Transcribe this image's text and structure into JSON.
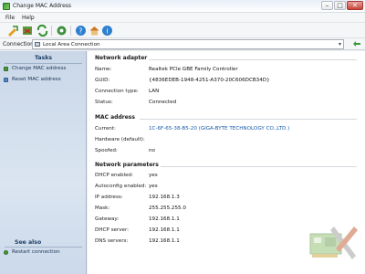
{
  "window": {
    "title": "Change MAC Address"
  },
  "titlebar_buttons": {
    "minimize": "–",
    "maximize": "□",
    "close": "✕"
  },
  "menu": [
    "File",
    "Help"
  ],
  "toolbar": {
    "buttons": [
      "apply-icon",
      "reset-icon",
      "restart-icon",
      "settings-icon",
      "help-icon",
      "home-icon",
      "info-icon"
    ]
  },
  "connection": {
    "label": "Connection:",
    "value": "Local Area Connection"
  },
  "tasks": {
    "header": "Tasks",
    "items": [
      "Change MAC address",
      "Reset MAC address"
    ],
    "see_also_header": "See also",
    "see_also_items": [
      "Restart connection"
    ]
  },
  "network_adapter": {
    "title": "Network adapter",
    "rows": [
      {
        "label": "Name:",
        "value": "Realtek PCIe GBE Family Controller"
      },
      {
        "label": "GUID:",
        "value": "{4836EDEB-1948-4251-A370-20C606DCB34D}"
      },
      {
        "label": "Connection type:",
        "value": "LAN"
      },
      {
        "label": "Status:",
        "value": "Connected"
      }
    ]
  },
  "mac_address": {
    "title": "MAC address",
    "rows": [
      {
        "label": "Current:",
        "value": "1C-6F-65-38-B5-20 (GIGA-BYTE TECHNOLOGY CO.,LTD.)"
      },
      {
        "label": "Hardware (default):",
        "value": ""
      },
      {
        "label": "Spoofed:",
        "value": "no"
      }
    ]
  },
  "network_parameters": {
    "title": "Network parameters",
    "rows": [
      {
        "label": "DHCP enabled:",
        "value": "yes"
      },
      {
        "label": "Autoconfig enabled:",
        "value": "yes"
      },
      {
        "label": "IP address:",
        "value": "192.168.1.3"
      },
      {
        "label": "Mask:",
        "value": "255.255.255.0"
      },
      {
        "label": "Gateway:",
        "value": "192.168.1.1"
      },
      {
        "label": "DHCP server:",
        "value": "192.168.1.1"
      },
      {
        "label": "DNS servers:",
        "value": "192.168.1.1"
      }
    ]
  },
  "colors": {
    "accent": "#1c5cab",
    "pane": "#dbe5f1"
  }
}
